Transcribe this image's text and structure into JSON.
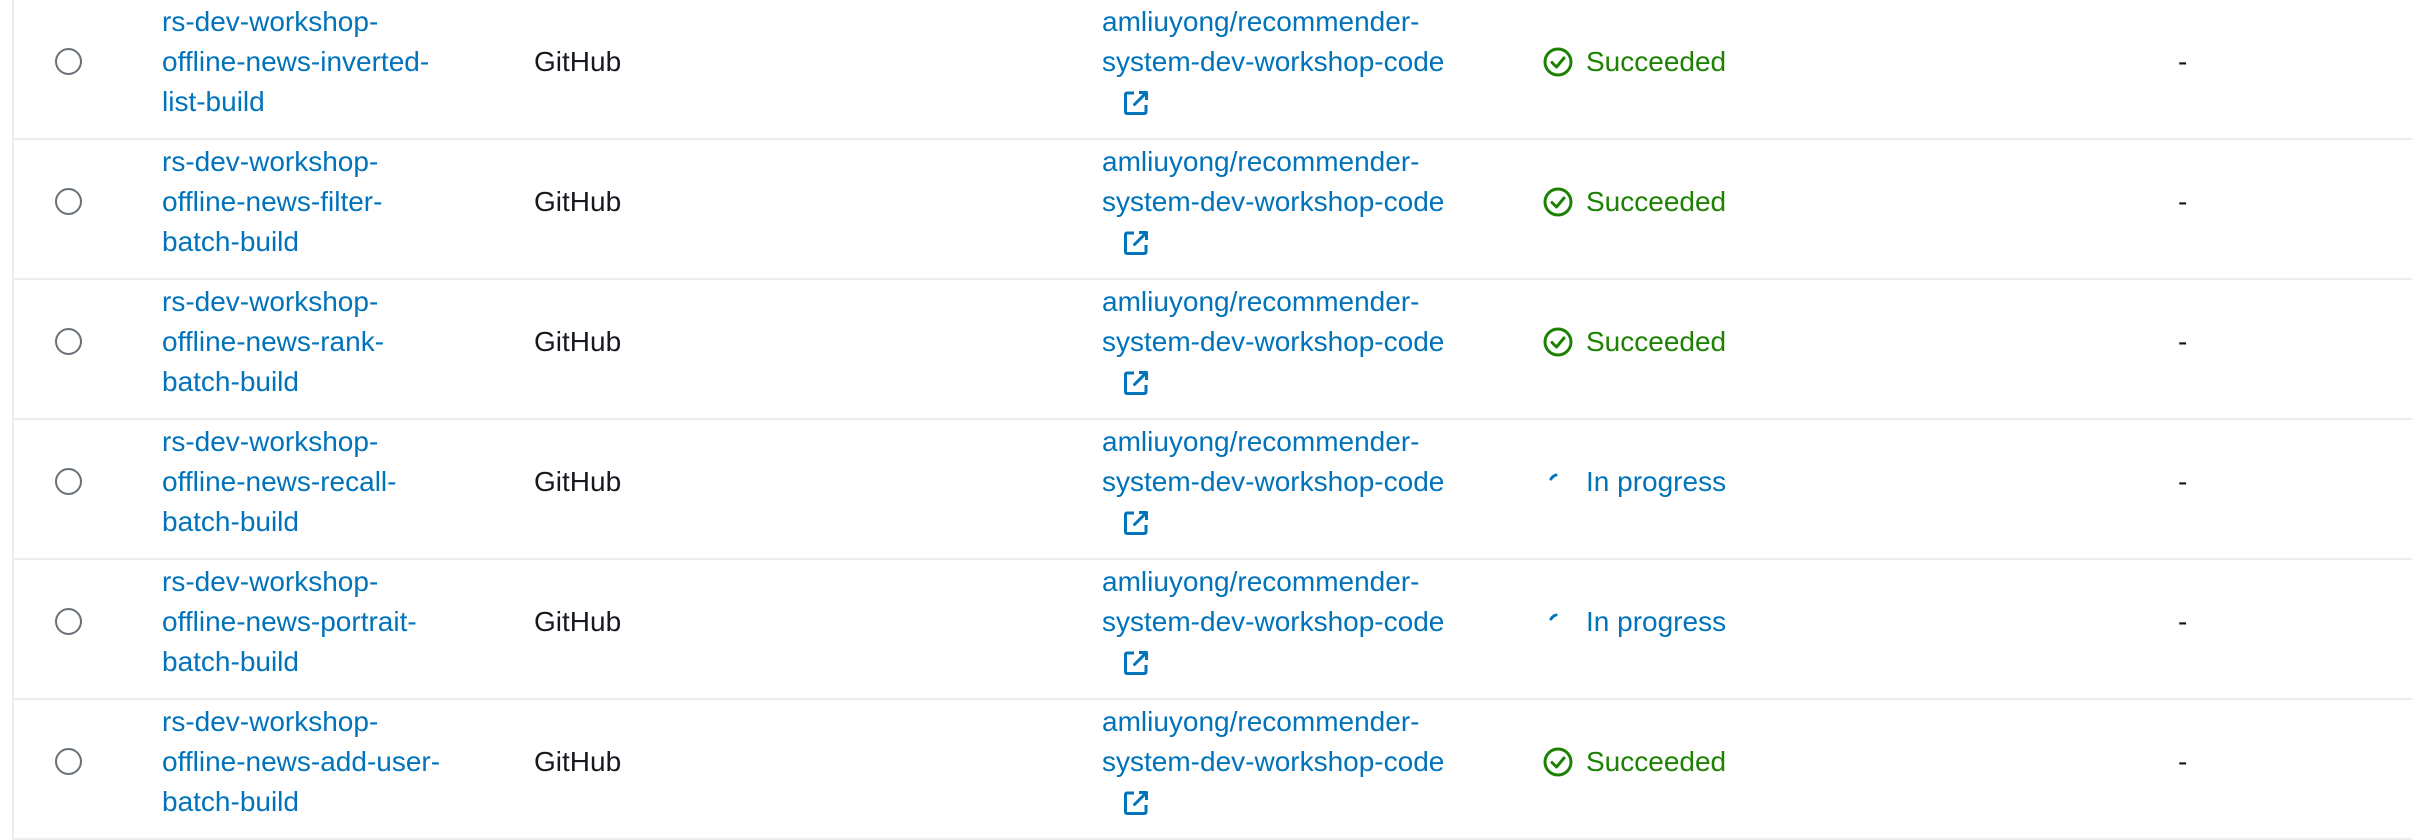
{
  "rows": [
    {
      "name_lines": [
        "rs-dev-workshop-",
        "offline-news-inverted-",
        "list-build"
      ],
      "provider": "GitHub",
      "repo_lines": [
        "amliuyong/recommender-",
        "system-dev-workshop-code"
      ],
      "status": "Succeeded",
      "status_type": "succeeded",
      "last": "-"
    },
    {
      "name_lines": [
        "rs-dev-workshop-",
        "offline-news-filter-",
        "batch-build"
      ],
      "provider": "GitHub",
      "repo_lines": [
        "amliuyong/recommender-",
        "system-dev-workshop-code"
      ],
      "status": "Succeeded",
      "status_type": "succeeded",
      "last": "-"
    },
    {
      "name_lines": [
        "rs-dev-workshop-",
        "offline-news-rank-",
        "batch-build"
      ],
      "provider": "GitHub",
      "repo_lines": [
        "amliuyong/recommender-",
        "system-dev-workshop-code"
      ],
      "status": "Succeeded",
      "status_type": "succeeded",
      "last": "-"
    },
    {
      "name_lines": [
        "rs-dev-workshop-",
        "offline-news-recall-",
        "batch-build"
      ],
      "provider": "GitHub",
      "repo_lines": [
        "amliuyong/recommender-",
        "system-dev-workshop-code"
      ],
      "status": "In progress",
      "status_type": "inprogress",
      "last": "-"
    },
    {
      "name_lines": [
        "rs-dev-workshop-",
        "offline-news-portrait-",
        "batch-build"
      ],
      "provider": "GitHub",
      "repo_lines": [
        "amliuyong/recommender-",
        "system-dev-workshop-code"
      ],
      "status": "In progress",
      "status_type": "inprogress",
      "last": "-"
    },
    {
      "name_lines": [
        "rs-dev-workshop-",
        "offline-news-add-user-",
        "batch-build"
      ],
      "provider": "GitHub",
      "repo_lines": [
        "amliuyong/recommender-",
        "system-dev-workshop-code"
      ],
      "status": "Succeeded",
      "status_type": "succeeded",
      "last": "-"
    }
  ],
  "icons": {
    "succeeded": "check-circle-icon",
    "inprogress": "spinner-icon",
    "repo_link": "external-link-icon"
  },
  "colors": {
    "link": "#0073bb",
    "success": "#1d8102",
    "divider": "#eaeded"
  }
}
